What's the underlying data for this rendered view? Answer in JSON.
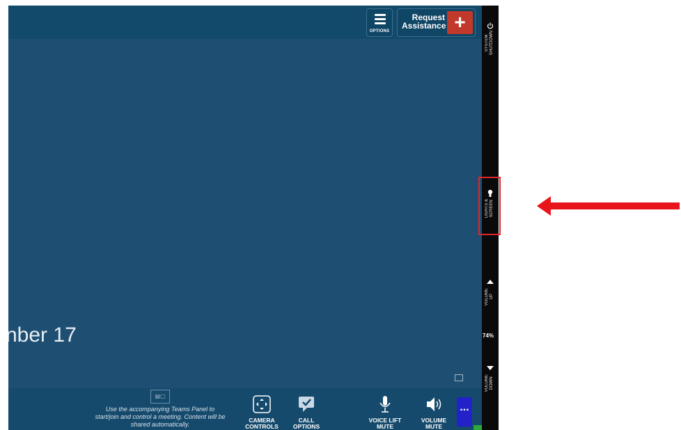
{
  "topbar": {
    "options_label": "OPTIONS",
    "assistance_label_line1": "Request",
    "assistance_label_line2": "Assistance",
    "assistance_icon": "plus-icon"
  },
  "main": {
    "date_fragment": "nber 17"
  },
  "bottombar": {
    "teams_text": "Use the accompanying Teams Panel to start/join and control a meeting. Content will be shared automatically.",
    "buttons": [
      {
        "label_line1": "CAMERA",
        "label_line2": "CONTROLS",
        "icon": "camera-controls-icon"
      },
      {
        "label_line1": "CALL",
        "label_line2": "OPTIONS",
        "icon": "call-options-icon"
      },
      {
        "label_line1": "VOICE LIFT",
        "label_line2": "MUTE",
        "icon": "microphone-icon"
      },
      {
        "label_line1": "VOLUME",
        "label_line2": "MUTE",
        "icon": "speaker-icon"
      }
    ],
    "more_label": "..."
  },
  "sidebar": {
    "shutdown_label": "SYSTEM\nSHUTDOWN",
    "lights_label": "LIGHTS &\nSCREEN",
    "volume_up_label": "VOLUME\nUP",
    "volume_percent": "74%",
    "volume_down_label": "VOLUME\nDOWN"
  },
  "colors": {
    "panel_bg": "#1e4f73",
    "topbar_bg": "#124a6b",
    "assist_red": "#c0392b",
    "highlight_red": "#e0262b",
    "more_blue": "#2222c8",
    "sidebar_bg": "#0a0a0a"
  }
}
